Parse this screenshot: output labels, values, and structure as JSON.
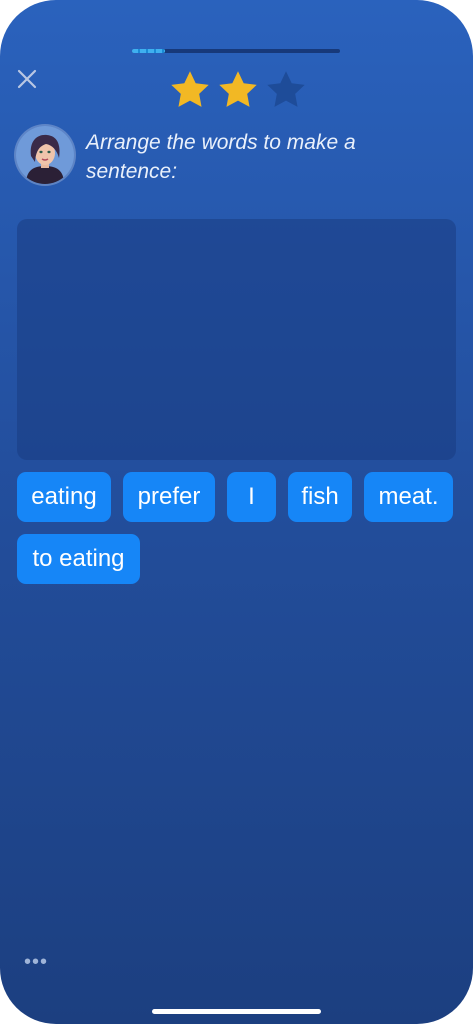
{
  "header": {
    "close_icon": "close-icon",
    "progress_fraction": 0.16,
    "stars_total": 3,
    "stars_earned": 2,
    "star_color_earned": "#f2b824",
    "star_color_empty": "#1e4c99"
  },
  "prompt": {
    "avatar_icon": "teacher-avatar",
    "text": "Arrange the words to make a sentence:"
  },
  "answer_area": {
    "placed_words": []
  },
  "word_bank": {
    "words": [
      "eating",
      "prefer",
      "I",
      "fish",
      "meat.",
      "to eating"
    ]
  },
  "footer": {
    "more_label": "•••"
  },
  "colors": {
    "chip": "#1686f7",
    "background_top": "#2a62bd",
    "background_bottom": "#1c3f80"
  }
}
